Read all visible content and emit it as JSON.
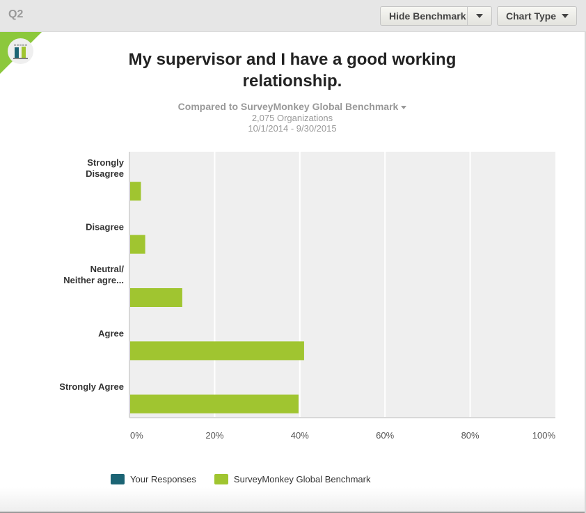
{
  "header": {
    "question_label": "Q2",
    "hide_benchmark_label": "Hide Benchmark",
    "chart_type_label": "Chart Type"
  },
  "icons": {
    "logo": "bar-chart-logo-icon",
    "dropdown": "caret-down-icon"
  },
  "subtitle": {
    "benchmark_label": "Compared to SurveyMonkey Global Benchmark",
    "organizations": "2,075 Organizations",
    "date_range": "10/1/2014 - 9/30/2015"
  },
  "colors": {
    "your_responses": "#1b6474",
    "benchmark": "#a0c530",
    "accent_corner": "#8cc83c",
    "plot_background": "#efefef"
  },
  "chart_data": {
    "type": "bar",
    "orientation": "horizontal",
    "title": "My supervisor and I have a good working relationship.",
    "categories": [
      "Strongly Disagree",
      "Disagree",
      "Neutral/ Neither agre...",
      "Agree",
      "Strongly Agree"
    ],
    "category_lines": [
      [
        "Strongly",
        "Disagree"
      ],
      [
        "Disagree"
      ],
      [
        "Neutral/",
        "Neither agre..."
      ],
      [
        "Agree"
      ],
      [
        "Strongly Agree"
      ]
    ],
    "series": [
      {
        "name": "Your Responses",
        "values": [
          null,
          null,
          null,
          null,
          null
        ]
      },
      {
        "name": "SurveyMonkey Global Benchmark",
        "values": [
          2.7,
          3.7,
          12.4,
          41.0,
          39.7
        ]
      }
    ],
    "xlabel": "",
    "ylabel": "",
    "xlim": [
      0,
      100
    ],
    "xticks": [
      "0%",
      "20%",
      "40%",
      "60%",
      "80%",
      "100%"
    ],
    "xtick_values": [
      0,
      20,
      40,
      60,
      80,
      100
    ],
    "grid": true,
    "legend_position": "bottom-left"
  }
}
